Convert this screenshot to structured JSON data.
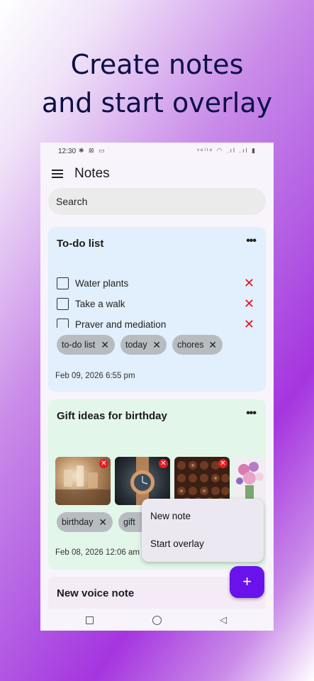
{
  "promo": {
    "line1": "Create notes",
    "line2": "and start overlay"
  },
  "status_bar": {
    "time": "12:30",
    "left_icons": "✱ ⊠ ▭",
    "right_icons": "ᵛᵒˡᵗᵉ ◠ .ıl .ıl ▮"
  },
  "app": {
    "title": "Notes",
    "search_placeholder": "Search"
  },
  "notes": {
    "todo": {
      "title": "To-do list",
      "more": "•••",
      "items": [
        {
          "text": "Water plants",
          "checked": false
        },
        {
          "text": "Take a walk",
          "checked": false
        },
        {
          "text": "Prayer and mediation",
          "checked": false
        }
      ],
      "tags": [
        "to-do list",
        "today",
        "chores"
      ],
      "date": "Feb 09, 2026 6:55 pm"
    },
    "gift": {
      "title": "Gift ideas for birthday",
      "more": "•••",
      "images": [
        "perfume-bottles-image",
        "wristwatch-image",
        "chocolates-image",
        "flower-bouquet-image"
      ],
      "tags": [
        "birthday",
        "gift"
      ],
      "date": "Feb 08, 2026 12:06 am"
    },
    "voice": {
      "title": "New voice note"
    }
  },
  "fab_menu": {
    "new_note": "New note",
    "start_overlay": "Start overlay"
  },
  "fab": {
    "label": "+"
  },
  "icons": {
    "remove": "✕",
    "delete": "✕",
    "nav_back": "◁"
  },
  "colors": {
    "accent": "#6a12eb",
    "delete_red": "#e0141b",
    "todo_card": "#e2effd",
    "gift_card": "#e3f6ea",
    "voice_card": "#f5ebf7",
    "chip": "#b7bcc1",
    "headline": "#0c1046"
  }
}
